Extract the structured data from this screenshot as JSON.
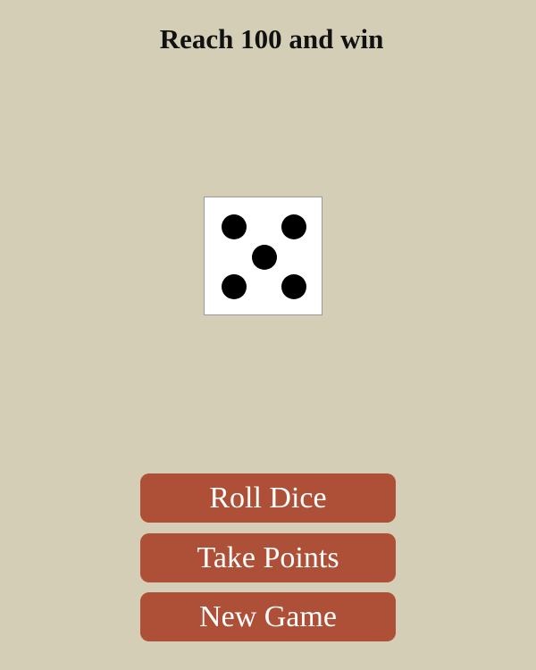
{
  "game": {
    "title": "Reach 100 and win",
    "die_value": 5
  },
  "colors": {
    "background": "#d3ceb5",
    "button": "#ae4f37",
    "button_text": "#ffffff"
  },
  "controls": {
    "roll_label": "Roll Dice",
    "take_label": "Take Points",
    "new_game_label": "New Game"
  }
}
